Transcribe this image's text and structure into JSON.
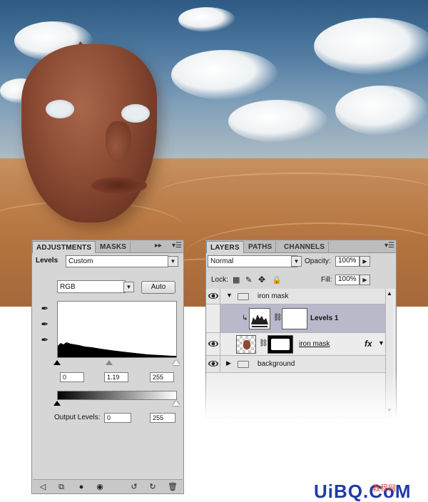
{
  "adjustments": {
    "tabs": [
      "ADJUSTMENTS",
      "MASKS"
    ],
    "levels_label": "Levels",
    "preset": "Custom",
    "channel": "RGB",
    "auto_label": "Auto",
    "input_levels": [
      "0",
      "1.19",
      "255"
    ],
    "output_label": "Output Levels:",
    "output_levels": [
      "0",
      "255"
    ],
    "eyedroppers": [
      "black-point-eyedropper-icon",
      "gray-point-eyedropper-icon",
      "white-point-eyedropper-icon"
    ],
    "bottom_icons": [
      "back-icon",
      "clip-layer-icon",
      "new-layer-icon",
      "visibility-eye-icon",
      "previous-state-icon",
      "reset-icon",
      "trash-icon"
    ]
  },
  "layers": {
    "tabs": [
      "LAYERS",
      "PATHS",
      "CHANNELS"
    ],
    "blend_mode": "Normal",
    "opacity_label": "Opacity:",
    "opacity": "100%",
    "lock_label": "Lock:",
    "fill_label": "Fill:",
    "fill": "100%",
    "items": [
      {
        "name": "iron mask",
        "kind": "group",
        "expanded": true
      },
      {
        "name": "Levels 1",
        "kind": "adjustment",
        "selected": true
      },
      {
        "name": "iron mask",
        "kind": "layer",
        "fx": "fx"
      },
      {
        "name": "background",
        "kind": "group",
        "expanded": false
      }
    ]
  },
  "watermark": {
    "text": "UiBQ.CoM",
    "sub": "教程网"
  },
  "colors": {
    "panel": "#d6d6d6",
    "selected_row": "#b8bacb",
    "watermark": "#1f3ba6"
  }
}
